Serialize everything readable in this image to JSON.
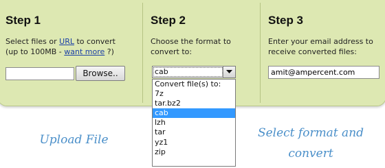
{
  "steps": [
    {
      "title": "Step 1",
      "desc_line1_a": "Select files or ",
      "desc_link_url": "URL",
      "desc_line1_b": " to convert",
      "desc_line2_a": "(up to 100MB - ",
      "desc_link_more": "want more",
      "desc_line2_b": " ?)",
      "file_input_value": "",
      "browse_label": "Browse.."
    },
    {
      "title": "Step 2",
      "desc_line1": "Choose the format to",
      "desc_line2": "convert to:",
      "selected_format": "cab",
      "options": [
        "Convert file(s) to:",
        "7z",
        "tar.bz2",
        "cab",
        "lzh",
        "tar",
        "yz1",
        "zip"
      ],
      "highlighted_option": "cab"
    },
    {
      "title": "Step 3",
      "desc_line1": "Enter your email address to",
      "desc_line2": "receive converted files:",
      "email_value": "amit@ampercent.com"
    }
  ],
  "captions": {
    "upload": "Upload File",
    "select_line1": "Select format and",
    "select_line2": "convert"
  },
  "colors": {
    "panel_bg": "#dde8b2",
    "link": "#1a3fa6",
    "highlight": "#3399ff",
    "caption": "#4a8fc9"
  }
}
